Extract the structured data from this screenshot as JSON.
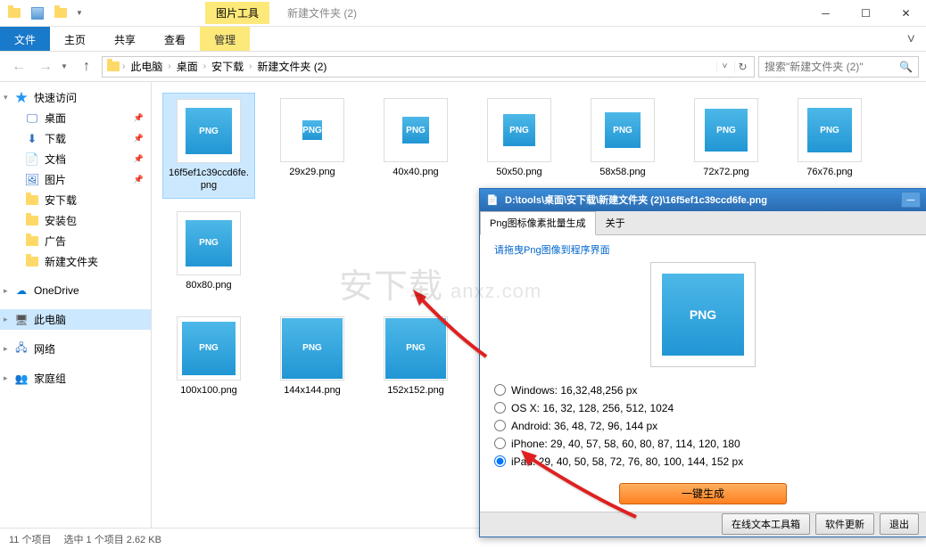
{
  "window": {
    "context_tab": "图片工具",
    "title": "新建文件夹 (2)",
    "min": "─",
    "max": "☐",
    "close": "✕"
  },
  "ribbon": {
    "file": "文件",
    "tabs": [
      "主页",
      "共享",
      "查看"
    ],
    "manage": "管理"
  },
  "breadcrumb": {
    "segs": [
      "此电脑",
      "桌面",
      "安下载",
      "新建文件夹 (2)"
    ]
  },
  "search": {
    "placeholder": "搜索\"新建文件夹 (2)\""
  },
  "sidebar": {
    "quick": "快速访问",
    "quick_items": [
      {
        "icon": "desktop",
        "label": "桌面",
        "pin": true
      },
      {
        "icon": "download",
        "label": "下载",
        "pin": true
      },
      {
        "icon": "doc",
        "label": "文档",
        "pin": true
      },
      {
        "icon": "pic",
        "label": "图片",
        "pin": true
      },
      {
        "icon": "folder",
        "label": "安下载",
        "pin": false
      },
      {
        "icon": "folder",
        "label": "安装包",
        "pin": false
      },
      {
        "icon": "folder",
        "label": "广告",
        "pin": false
      },
      {
        "icon": "folder",
        "label": "新建文件夹",
        "pin": false
      }
    ],
    "onedrive": "OneDrive",
    "thispc": "此电脑",
    "network": "网络",
    "homegroup": "家庭组"
  },
  "files": {
    "row1": [
      {
        "label": "16f5ef1c39ccd6fe.png",
        "selected": true,
        "size": 52
      },
      {
        "label": "29x29.png",
        "size": 22
      },
      {
        "label": "40x40.png",
        "size": 30
      },
      {
        "label": "50x50.png",
        "size": 36
      },
      {
        "label": "58x58.png",
        "size": 40
      },
      {
        "label": "72x72.png",
        "size": 48
      },
      {
        "label": "76x76.png",
        "size": 50
      },
      {
        "label": "80x80.png",
        "size": 52
      }
    ],
    "row2": [
      {
        "label": "100x100.png",
        "size": 60
      },
      {
        "label": "144x144.png",
        "size": 68
      },
      {
        "label": "152x152.png",
        "size": 68
      }
    ]
  },
  "status": {
    "count": "11 个项目",
    "selected": "选中 1 个项目  2.62 KB"
  },
  "tool": {
    "title": "D:\\tools\\桌面\\安下载\\新建文件夹 (2)\\16f5ef1c39ccd6fe.png",
    "tab_active": "Png图标像素批量生成",
    "tab2": "关于",
    "hint": "请拖曳Png图像到程序界面",
    "radios": [
      {
        "key": "windows",
        "label": "Windows: 16,32,48,256 px"
      },
      {
        "key": "osx",
        "label": "OS X: 16, 32, 128, 256, 512, 1024"
      },
      {
        "key": "android",
        "label": "Android: 36, 48, 72, 96, 144 px"
      },
      {
        "key": "iphone",
        "label": "iPhone: 29, 40, 57, 58, 60, 80, 87, 114, 120, 180"
      },
      {
        "key": "ipad",
        "label": "iPad: 29, 40, 50, 58, 72, 76, 80, 100, 144, 152 px",
        "checked": true
      }
    ],
    "generate": "一键生成",
    "footer": {
      "toolbox": "在线文本工具箱",
      "update": "软件更新",
      "exit": "退出"
    }
  },
  "watermark": {
    "cn": "安下载",
    "en": "anxz.com"
  }
}
